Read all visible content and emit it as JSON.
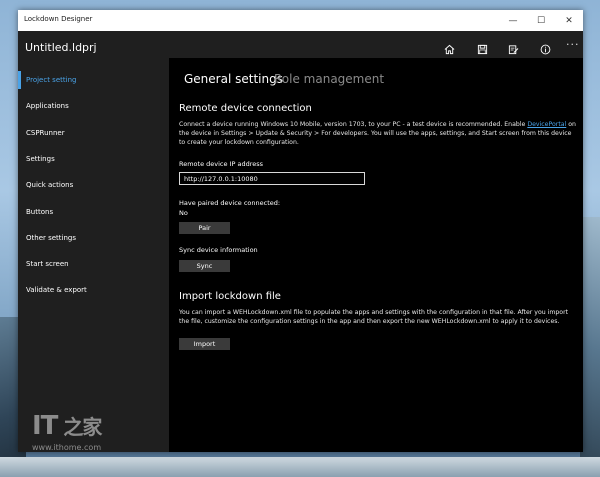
{
  "window": {
    "title": "Lockdown Designer",
    "controls": {
      "minimize": "—",
      "maximize": "☐",
      "close": "✕"
    }
  },
  "appbar": {
    "document_title": "Untitled.ldprj",
    "buttons": [
      "home-icon",
      "save-icon",
      "edit-icon",
      "info-icon"
    ],
    "more": "···"
  },
  "sidebar": {
    "items": [
      {
        "label": "Project setting",
        "active": true
      },
      {
        "label": "Applications"
      },
      {
        "label": "CSPRunner"
      },
      {
        "label": "Settings"
      },
      {
        "label": "Quick actions"
      },
      {
        "label": "Buttons"
      },
      {
        "label": "Other settings"
      },
      {
        "label": "Start screen"
      },
      {
        "label": "Validate & export"
      }
    ]
  },
  "tabs": [
    {
      "label": "General settings",
      "active": true
    },
    {
      "label": "Role management",
      "active": false
    }
  ],
  "remote": {
    "title": "Remote device connection",
    "desc_before_link": "Connect a device running Windows 10 Mobile, version 1703, to your PC - a test device is recommended. Enable ",
    "desc_link": "DevicePortal",
    "desc_after_link": " on the device in Settings > Update & Security > For developers. You will use the apps, settings, and Start screen from this device to create your lockdown configuration.",
    "ip_label": "Remote device IP address",
    "ip_value": "http://127.0.0.1:10080",
    "paired_label": "Have paired device connected:",
    "paired_value": "No",
    "pair_button": "Pair",
    "sync_label": "Sync device information",
    "sync_button": "Sync"
  },
  "import": {
    "title": "Import lockdown file",
    "desc": "You can import a WEHLockdown.xml file to populate the apps and settings with the configuration in that file. After you import the file, customize the configuration settings in the app and then export the new WEHLockdown.xml to apply it to devices.",
    "button": "Import"
  },
  "watermark": {
    "logo": "IT",
    "logo_cn": "之家",
    "url": "www.ithome.com"
  },
  "colors": {
    "accent": "#4aa3e8",
    "sidebar": "#1f1f1f",
    "content": "#000000",
    "button": "#3a3a3a"
  }
}
